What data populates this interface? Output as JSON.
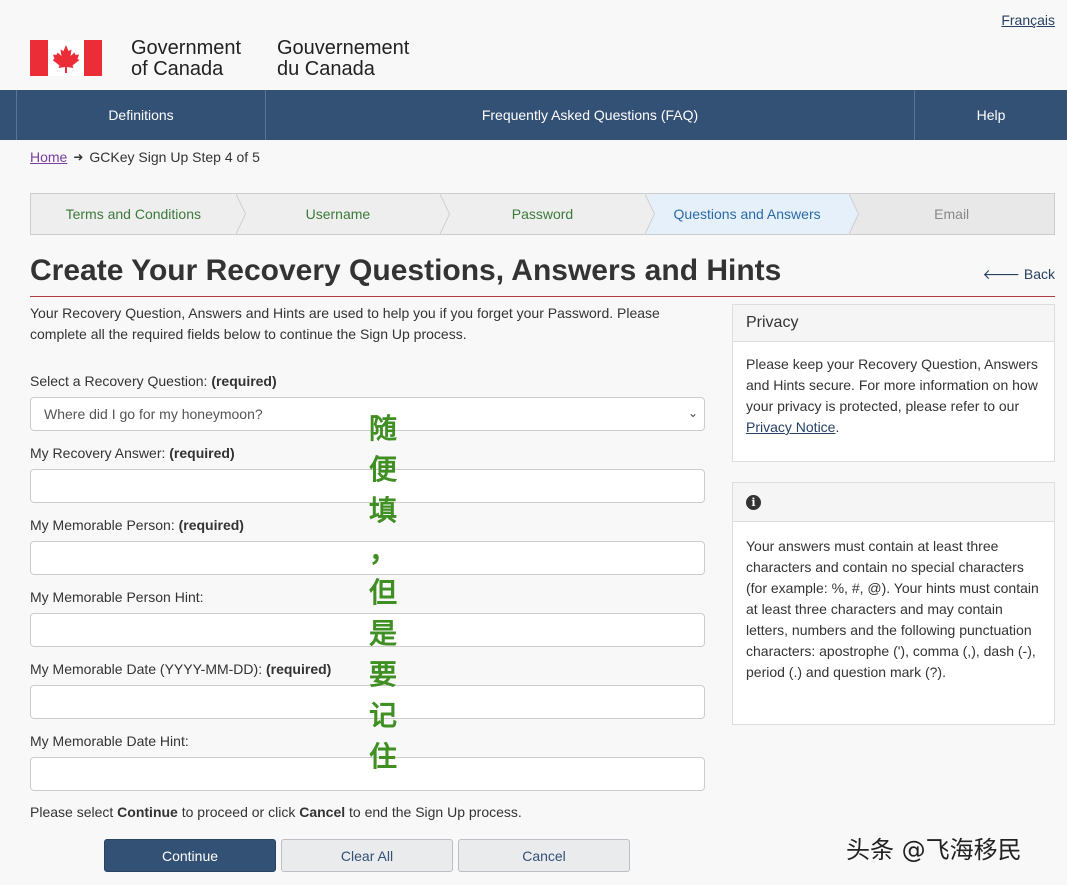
{
  "header": {
    "language_link": "Français",
    "gov_en_line1": "Government",
    "gov_en_line2": "of Canada",
    "gov_fr_line1": "Gouvernement",
    "gov_fr_line2": "du Canada",
    "flag_icon": "canada-flag-icon",
    "colors": {
      "flag_red": "#eb2d37",
      "nav_bg": "#335075"
    }
  },
  "nav": {
    "items": [
      {
        "label": "Definitions"
      },
      {
        "label": "Frequently Asked Questions (FAQ)"
      },
      {
        "label": "Help"
      }
    ]
  },
  "breadcrumb": {
    "home": "Home",
    "current": "GCKey Sign Up Step 4 of 5"
  },
  "steps": [
    {
      "label": "Terms and Conditions",
      "state": "done"
    },
    {
      "label": "Username",
      "state": "done"
    },
    {
      "label": "Password",
      "state": "done"
    },
    {
      "label": "Questions and Answers",
      "state": "active"
    },
    {
      "label": "Email",
      "state": "future"
    }
  ],
  "page": {
    "title": "Create Your Recovery Questions, Answers and Hints",
    "back_label": "Back",
    "intro": "Your Recovery Question, Answers and Hints are used to help you if you forget your Password. Please complete all the required fields below to continue the Sign Up process."
  },
  "form": {
    "required_tag": "(required)",
    "question_label": "Select a Recovery Question:",
    "question_value": "Where did I go for my honeymoon?",
    "answer_label": "My Recovery Answer:",
    "answer_value": "",
    "person_label": "My Memorable Person:",
    "person_value": "",
    "person_hint_label": "My Memorable Person Hint:",
    "person_hint_value": "",
    "date_label": "My Memorable Date (YYYY-MM-DD):",
    "date_value": "",
    "date_hint_label": "My Memorable Date Hint:",
    "date_hint_value": "",
    "proceed_prefix": "Please select",
    "proceed_continue": "Continue",
    "proceed_middle": "to proceed or click",
    "proceed_cancel": "Cancel",
    "proceed_suffix": "to end the Sign Up process.",
    "continue_label": "Continue",
    "clear_label": "Clear All",
    "cancel_label": "Cancel"
  },
  "privacy_panel": {
    "title": "Privacy",
    "body_prefix": "Please keep your Recovery Question, Answers and Hints secure. For more information on how your privacy is protected, please refer to our",
    "link": "Privacy Notice",
    "body_suffix": "."
  },
  "info_panel": {
    "icon": "info-icon",
    "body": "Your answers must contain at least three characters and contain no special characters (for example: %, #, @). Your hints must contain at least three characters and may contain letters, numbers and the following punctuation characters: apostrophe ('), comma (,), dash (-), period (.) and question mark (?)."
  },
  "overlay": {
    "chars": [
      "随",
      "便",
      "填",
      "，",
      "但",
      "是",
      "要",
      "记",
      "住"
    ],
    "color": "#3f8f22",
    "watermark": "头条 @飞海移民"
  }
}
